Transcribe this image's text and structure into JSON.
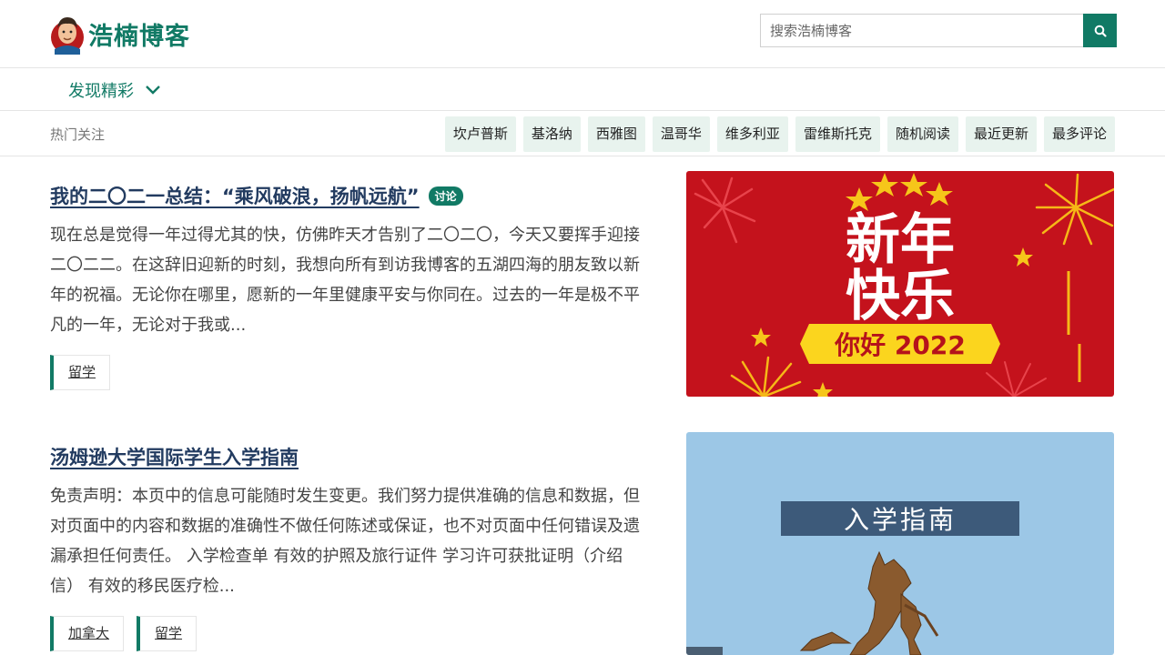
{
  "site": {
    "title": "浩楠博客"
  },
  "search": {
    "placeholder": "搜索浩楠博客",
    "icon": "search-icon"
  },
  "nav": {
    "discover_label": "发现精彩",
    "discover_icon": "chevron-down-icon"
  },
  "hot": {
    "label": "热门关注",
    "tags": [
      "坎卢普斯",
      "基洛纳",
      "西雅图",
      "温哥华",
      "维多利亚",
      "雷维斯托克",
      "随机阅读",
      "最近更新",
      "最多评论"
    ]
  },
  "articles": [
    {
      "title": "我的二〇二一总结：“乘风破浪，扬帆远航”",
      "badge": "讨论",
      "excerpt": "现在总是觉得一年过得尤其的快，仿佛昨天才告别了二〇二〇，今天又要挥手迎接二〇二二。在这辞旧迎新的时刻，我想向所有到访我博客的五湖四海的朋友致以新年的祝福。无论你在哪里，愿新的一年里健康平安与你同在。过去的一年是极不平凡的一年，无论对于我或...",
      "tags": [
        "留学"
      ],
      "image": {
        "line1": "新年",
        "line2": "快乐",
        "banner": "你好 2022"
      }
    },
    {
      "title": "汤姆逊大学国际学生入学指南",
      "excerpt": "免责声明：本页中的信息可能随时发生变更。我们努力提供准确的信息和数据，但对页面中的内容和数据的准确性不做任何陈述或保证，也不对页面中任何错误及遗漏承担任何责任。 入学检查单 有效的护照及旅行证件 学习许可获批证明（介绍信） 有效的移民医疗检...",
      "tags": [
        "加拿大",
        "留学"
      ],
      "image": {
        "caption": "入学指南"
      }
    }
  ],
  "colors": {
    "brand": "#117a65",
    "title": "#223b60",
    "tag_bg": "#e8f3ee",
    "red": "#c4121c",
    "sky": "#9cc7e6"
  }
}
